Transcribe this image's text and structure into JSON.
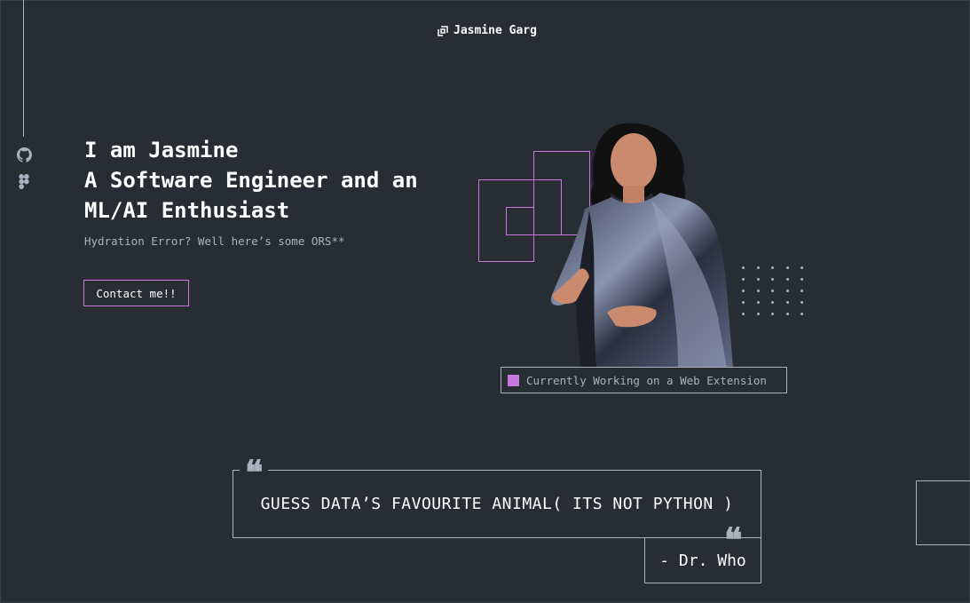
{
  "header": {
    "logo_name": "Jasmine Garg"
  },
  "sidebar": {
    "icons": [
      "github-icon",
      "figma-icon"
    ]
  },
  "hero": {
    "line1": "I am Jasmine",
    "line2": "A Software Engineer and an",
    "line3": "ML/AI Enthusiast",
    "subtitle": "Hydration Error? Well here’s some ORS**",
    "contact_label": "Contact me!!"
  },
  "status": {
    "text": "Currently Working on a Web Extension"
  },
  "quote": {
    "text": "GUESS DATA’S FAVOURITE ANIMAL( ITS NOT PYTHON )",
    "author": "- Dr. Who"
  },
  "colors": {
    "background": "#282c33",
    "accent": "#c778dd",
    "muted": "#abb2bf",
    "text": "#ffffff"
  }
}
